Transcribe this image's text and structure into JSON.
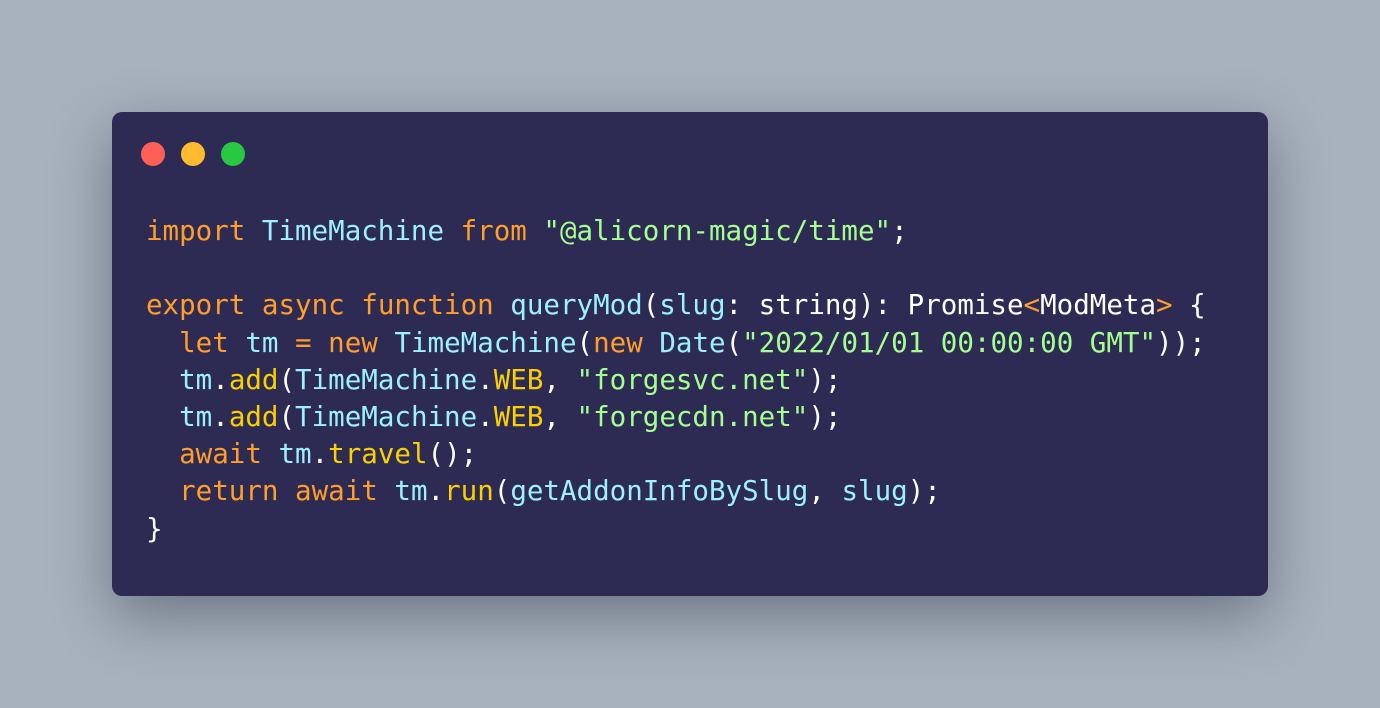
{
  "colors": {
    "background": "#a7b2bd",
    "window": "#2d2a53",
    "close": "#ff5f57",
    "minimize": "#febc2e",
    "maximize": "#28c840",
    "keyword": "#ff9e2b",
    "identifier": "#9df0ff",
    "string": "#a5ff90",
    "property": "#fad000",
    "plain": "#ffffff"
  },
  "window_controls": [
    "close",
    "minimize",
    "maximize"
  ],
  "code": {
    "lines": [
      [
        {
          "t": "import",
          "k": "keyword"
        },
        {
          "t": " ",
          "k": "plain"
        },
        {
          "t": "TimeMachine",
          "k": "identifier"
        },
        {
          "t": " ",
          "k": "plain"
        },
        {
          "t": "from",
          "k": "keyword"
        },
        {
          "t": " ",
          "k": "plain"
        },
        {
          "t": "\"@alicorn-magic/time\"",
          "k": "string"
        },
        {
          "t": ";",
          "k": "plain"
        }
      ],
      [],
      [
        {
          "t": "export",
          "k": "keyword"
        },
        {
          "t": " ",
          "k": "plain"
        },
        {
          "t": "async",
          "k": "keyword"
        },
        {
          "t": " ",
          "k": "plain"
        },
        {
          "t": "function",
          "k": "keyword"
        },
        {
          "t": " ",
          "k": "plain"
        },
        {
          "t": "queryMod",
          "k": "identifier"
        },
        {
          "t": "(",
          "k": "plain"
        },
        {
          "t": "slug",
          "k": "identifier"
        },
        {
          "t": ": string): Promise",
          "k": "plain"
        },
        {
          "t": "<",
          "k": "keyword"
        },
        {
          "t": "ModMeta",
          "k": "plain"
        },
        {
          "t": ">",
          "k": "keyword"
        },
        {
          "t": " {",
          "k": "plain"
        }
      ],
      [
        {
          "t": "  ",
          "k": "plain"
        },
        {
          "t": "let",
          "k": "keyword"
        },
        {
          "t": " ",
          "k": "plain"
        },
        {
          "t": "tm",
          "k": "identifier"
        },
        {
          "t": " ",
          "k": "plain"
        },
        {
          "t": "=",
          "k": "keyword"
        },
        {
          "t": " ",
          "k": "plain"
        },
        {
          "t": "new",
          "k": "keyword"
        },
        {
          "t": " ",
          "k": "plain"
        },
        {
          "t": "TimeMachine",
          "k": "identifier"
        },
        {
          "t": "(",
          "k": "plain"
        },
        {
          "t": "new",
          "k": "keyword"
        },
        {
          "t": " ",
          "k": "plain"
        },
        {
          "t": "Date",
          "k": "identifier"
        },
        {
          "t": "(",
          "k": "plain"
        },
        {
          "t": "\"2022/01/01 00:00:00 GMT\"",
          "k": "string"
        },
        {
          "t": "));",
          "k": "plain"
        }
      ],
      [
        {
          "t": "  ",
          "k": "plain"
        },
        {
          "t": "tm",
          "k": "identifier"
        },
        {
          "t": ".",
          "k": "plain"
        },
        {
          "t": "add",
          "k": "property"
        },
        {
          "t": "(",
          "k": "plain"
        },
        {
          "t": "TimeMachine",
          "k": "identifier"
        },
        {
          "t": ".",
          "k": "plain"
        },
        {
          "t": "WEB",
          "k": "property"
        },
        {
          "t": ", ",
          "k": "plain"
        },
        {
          "t": "\"forgesvc.net\"",
          "k": "string"
        },
        {
          "t": ");",
          "k": "plain"
        }
      ],
      [
        {
          "t": "  ",
          "k": "plain"
        },
        {
          "t": "tm",
          "k": "identifier"
        },
        {
          "t": ".",
          "k": "plain"
        },
        {
          "t": "add",
          "k": "property"
        },
        {
          "t": "(",
          "k": "plain"
        },
        {
          "t": "TimeMachine",
          "k": "identifier"
        },
        {
          "t": ".",
          "k": "plain"
        },
        {
          "t": "WEB",
          "k": "property"
        },
        {
          "t": ", ",
          "k": "plain"
        },
        {
          "t": "\"forgecdn.net\"",
          "k": "string"
        },
        {
          "t": ");",
          "k": "plain"
        }
      ],
      [
        {
          "t": "  ",
          "k": "plain"
        },
        {
          "t": "await",
          "k": "keyword"
        },
        {
          "t": " ",
          "k": "plain"
        },
        {
          "t": "tm",
          "k": "identifier"
        },
        {
          "t": ".",
          "k": "plain"
        },
        {
          "t": "travel",
          "k": "property"
        },
        {
          "t": "();",
          "k": "plain"
        }
      ],
      [
        {
          "t": "  ",
          "k": "plain"
        },
        {
          "t": "return",
          "k": "keyword"
        },
        {
          "t": " ",
          "k": "plain"
        },
        {
          "t": "await",
          "k": "keyword"
        },
        {
          "t": " ",
          "k": "plain"
        },
        {
          "t": "tm",
          "k": "identifier"
        },
        {
          "t": ".",
          "k": "plain"
        },
        {
          "t": "run",
          "k": "property"
        },
        {
          "t": "(",
          "k": "plain"
        },
        {
          "t": "getAddonInfoBySlug",
          "k": "identifier"
        },
        {
          "t": ", ",
          "k": "plain"
        },
        {
          "t": "slug",
          "k": "identifier"
        },
        {
          "t": ");",
          "k": "plain"
        }
      ],
      [
        {
          "t": "}",
          "k": "plain"
        }
      ]
    ]
  }
}
